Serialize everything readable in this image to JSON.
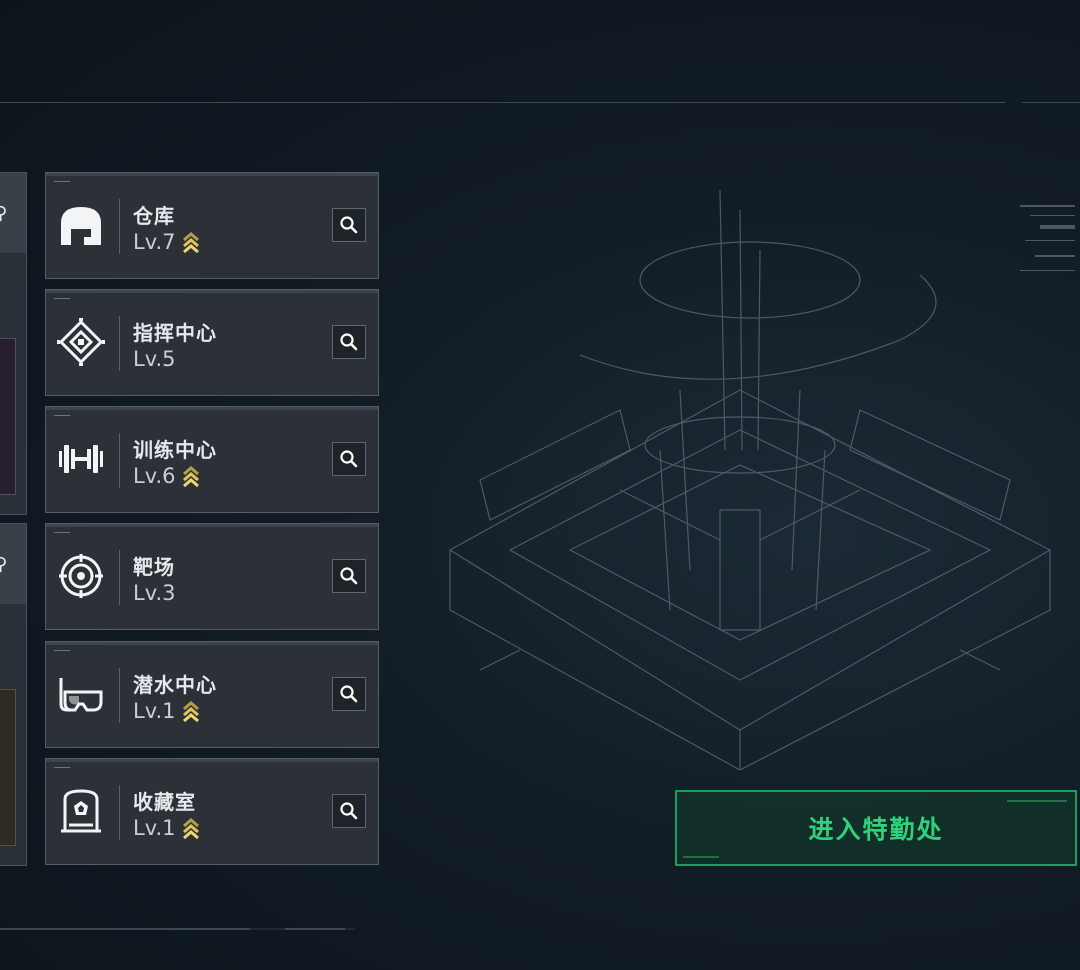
{
  "facilities": [
    {
      "name": "仓库",
      "level": "Lv.7",
      "upgradable": true,
      "icon": "warehouse-icon"
    },
    {
      "name": "指挥中心",
      "level": "Lv.5",
      "upgradable": false,
      "icon": "command-center-icon"
    },
    {
      "name": "训练中心",
      "level": "Lv.6",
      "upgradable": true,
      "icon": "dumbbell-icon"
    },
    {
      "name": "靶场",
      "level": "Lv.3",
      "upgradable": false,
      "icon": "target-icon"
    },
    {
      "name": "潜水中心",
      "level": "Lv.1",
      "upgradable": true,
      "icon": "diving-mask-icon"
    },
    {
      "name": "收藏室",
      "level": "Lv.1",
      "upgradable": true,
      "icon": "collection-display-icon"
    }
  ],
  "enter_button": {
    "label": "进入特勤处"
  },
  "colors": {
    "accent_green": "#2ed27d",
    "upgrade_gold": "#e3c35a",
    "card_bg": "#2c3137"
  }
}
